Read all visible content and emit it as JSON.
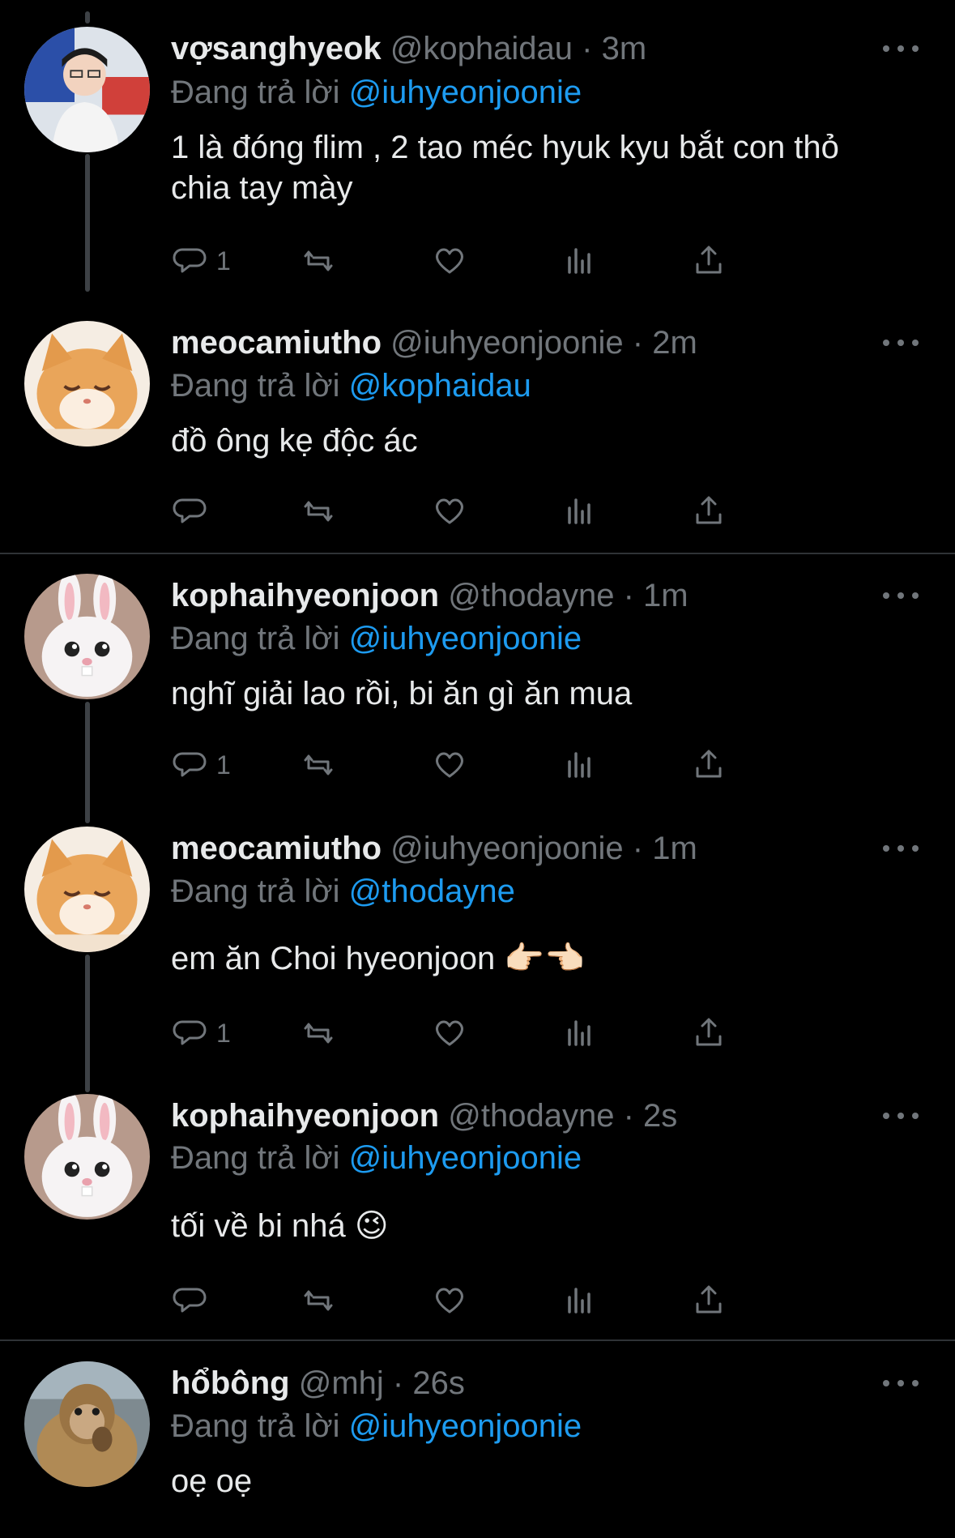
{
  "tweets": [
    {
      "name": "vợsanghyeok",
      "handle": "@kophaidau",
      "time": "3m",
      "reply_prefix": "Đang trả lời",
      "reply_to": "@iuhyeonjoonie",
      "text": "1 là đóng flim , 2 tao méc hyuk kyu   bắt con thỏ chia tay mày",
      "reply_count": "1",
      "avatar": "person-avatar"
    },
    {
      "name": "meocamiutho",
      "handle": "@iuhyeonjoonie",
      "time": "2m",
      "reply_prefix": "Đang trả lời",
      "reply_to": "@kophaidau",
      "text": "đồ ông kẹ độc ác",
      "reply_count": "",
      "avatar": "cat-avatar"
    },
    {
      "name": "kophaihyeonjoon",
      "handle": "@thodayne",
      "time": "1m",
      "reply_prefix": "Đang trả lời",
      "reply_to": "@iuhyeonjoonie",
      "text": "nghĩ giải lao rồi, bi ăn gì ăn mua",
      "reply_count": "1",
      "avatar": "bunny-avatar"
    },
    {
      "name": "meocamiutho",
      "handle": "@iuhyeonjoonie",
      "time": "1m",
      "reply_prefix": "Đang trả lời",
      "reply_to": "@thodayne",
      "text": "em ăn Choi hyeonjoon 👉🏻👈🏻",
      "reply_count": "1",
      "avatar": "cat-avatar"
    },
    {
      "name": "kophaihyeonjoon",
      "handle": "@thodayne",
      "time": "2s",
      "reply_prefix": "Đang trả lời",
      "reply_to": "@iuhyeonjoonie",
      "text": "tối về bi nhá 😉",
      "reply_count": "",
      "avatar": "bunny-avatar"
    },
    {
      "name": "hổbông",
      "handle": "@mhj",
      "time": "26s",
      "reply_prefix": "Đang trả lời",
      "reply_to": "@iuhyeonjoonie",
      "text": "oẹ oẹ",
      "reply_count": "",
      "avatar": "monkey-avatar"
    }
  ],
  "separator": "·",
  "colors": {
    "background": "#000000",
    "text": "#e7e9ea",
    "muted": "#71767b",
    "accent": "#1d9bf0"
  }
}
